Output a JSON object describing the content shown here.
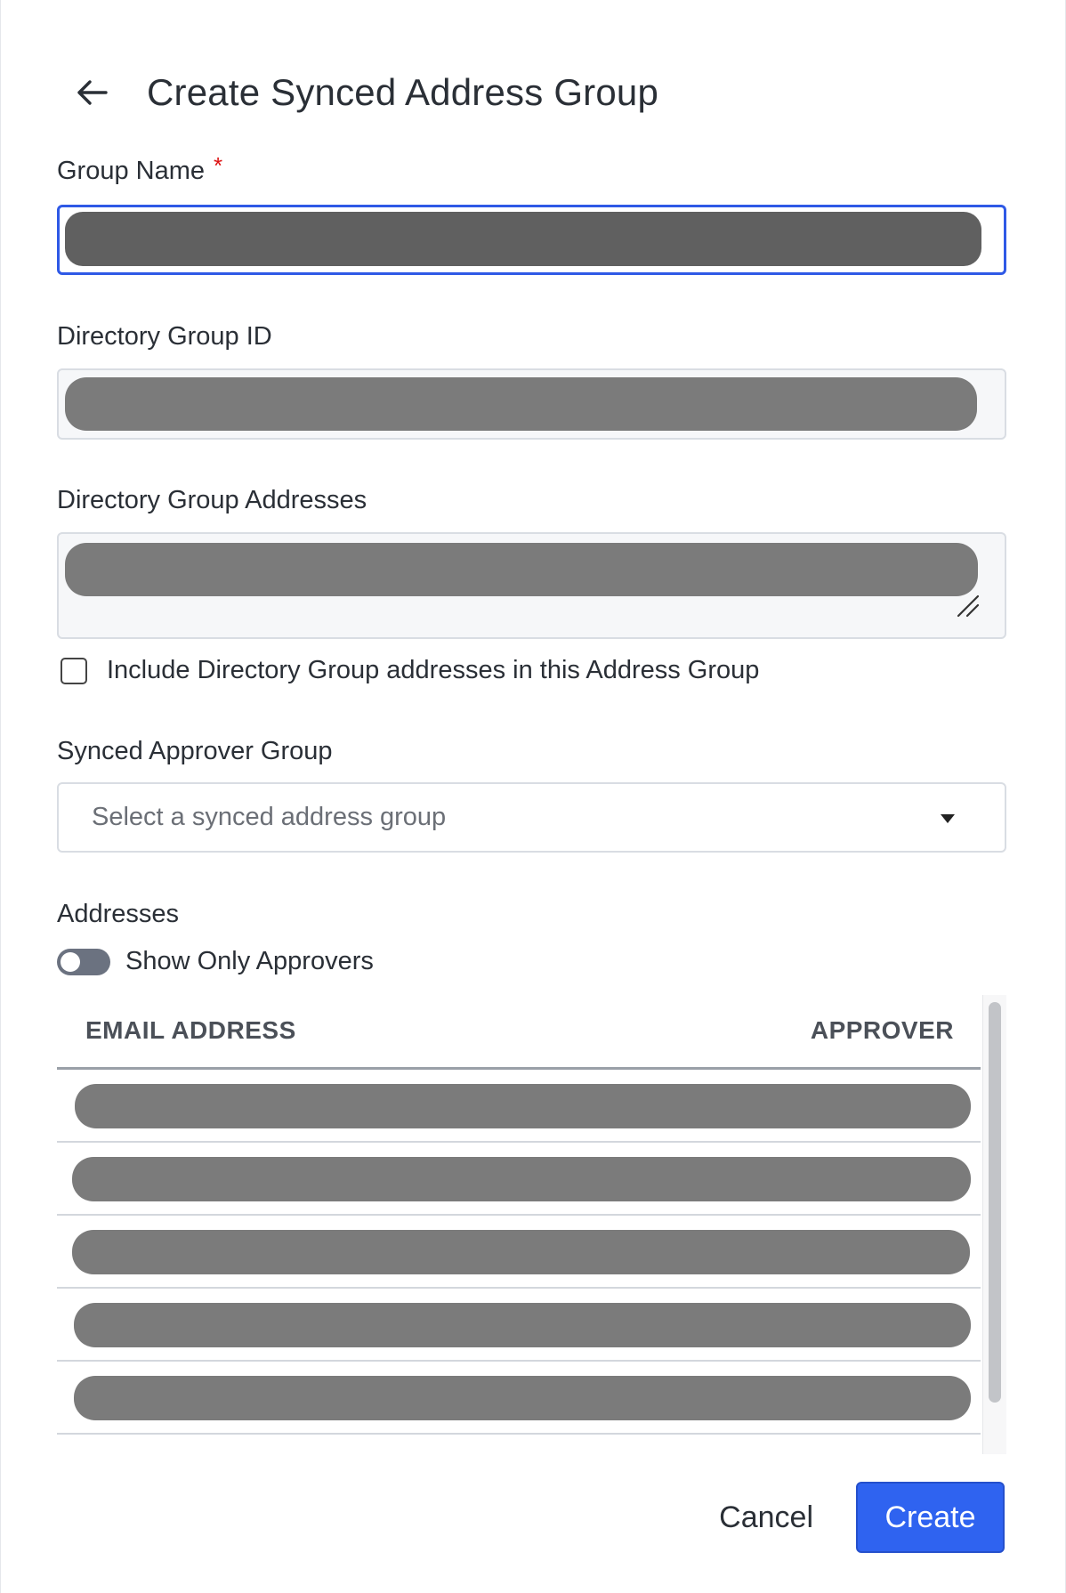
{
  "header": {
    "title": "Create Synced Address Group",
    "back_icon": "arrow-left-icon"
  },
  "form": {
    "group_name": {
      "label": "Group Name",
      "required_marker": "*"
    },
    "directory_group_id": {
      "label": "Directory Group ID"
    },
    "directory_group_addresses": {
      "label": "Directory Group Addresses"
    },
    "include_checkbox": {
      "label": "Include Directory Group addresses in this Address Group",
      "checked": false
    },
    "synced_approver_group": {
      "label": "Synced Approver Group",
      "placeholder": "Select a synced address group"
    }
  },
  "addresses": {
    "label": "Addresses",
    "toggle_label": "Show Only Approvers",
    "toggle_on": false,
    "columns": [
      "EMAIL ADDRESS",
      "APPROVER"
    ]
  },
  "footer": {
    "cancel_label": "Cancel",
    "create_label": "Create"
  },
  "colors": {
    "primary": "#2f63f0",
    "focus_border": "#2f59e6",
    "required": "#dd1111",
    "redaction": "#7b7b7b"
  }
}
